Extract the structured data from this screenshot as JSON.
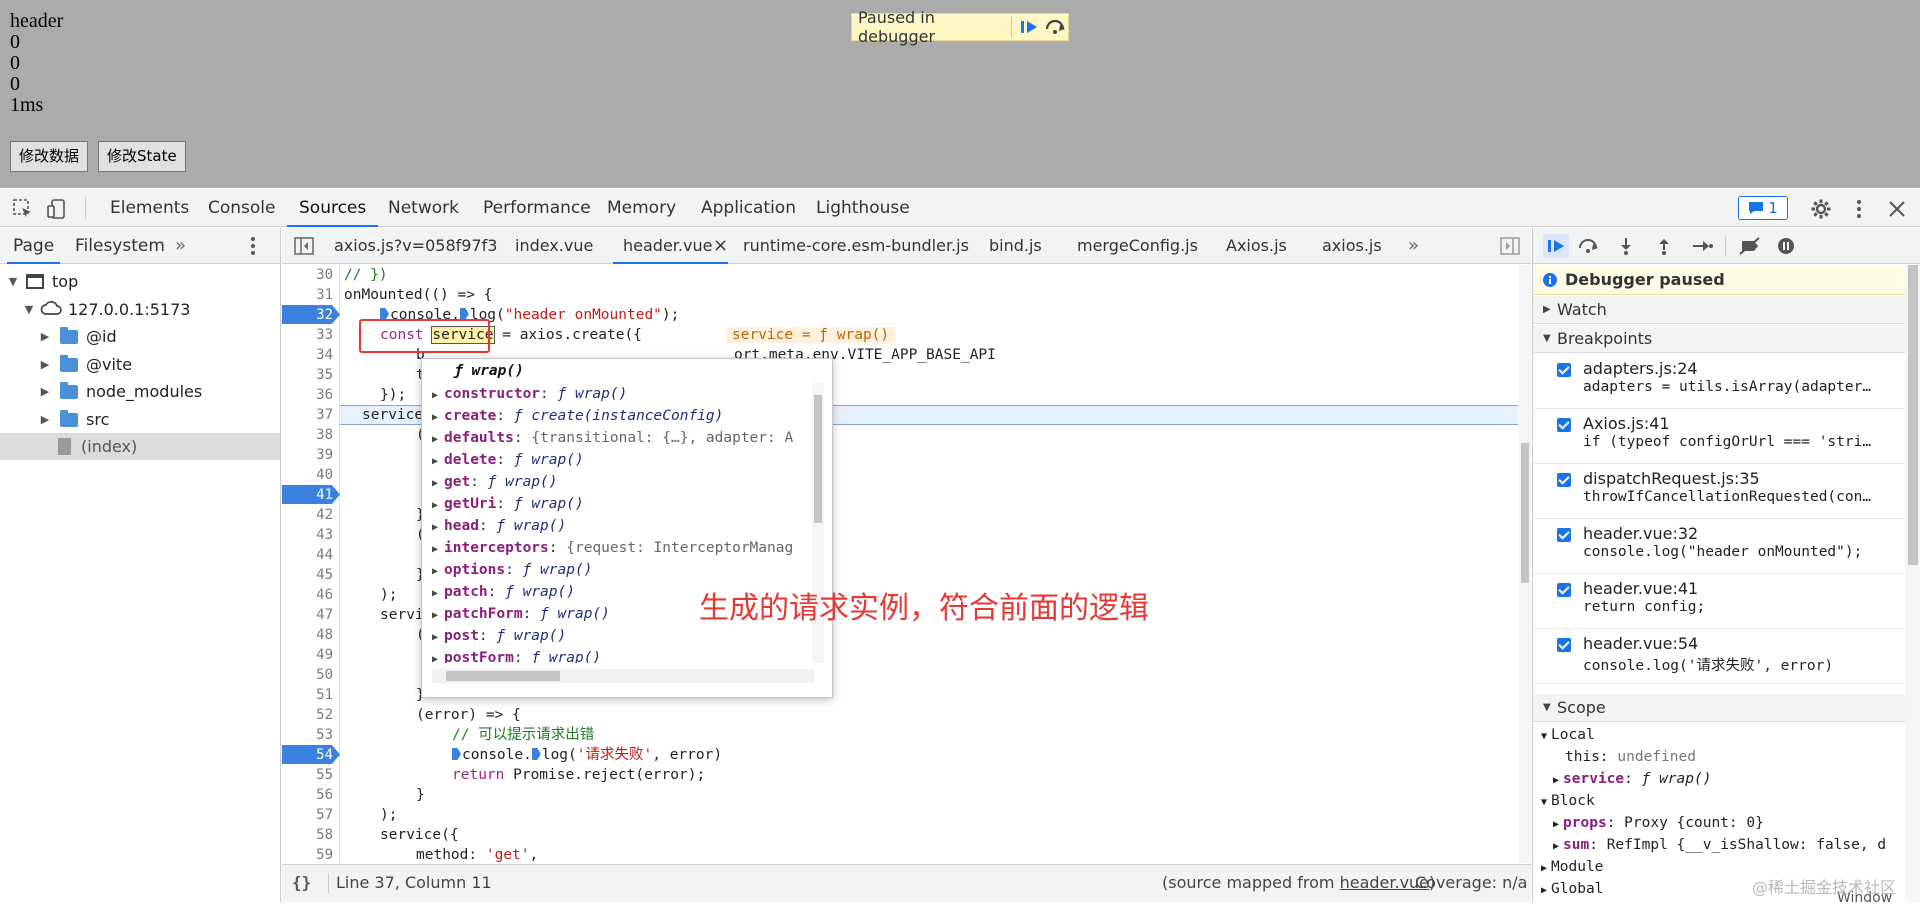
{
  "preview": {
    "lines": [
      "header",
      "0",
      "0",
      "0",
      "1ms"
    ],
    "buttons": [
      "修改数据",
      "修改State"
    ],
    "paused_label": "Paused in debugger"
  },
  "devtools": {
    "tabs": [
      "Elements",
      "Console",
      "Sources",
      "Network",
      "Performance",
      "Memory",
      "Application",
      "Lighthouse"
    ],
    "active_tab": "Sources",
    "issues_count": "1"
  },
  "navigator": {
    "tabs": [
      "Page",
      "Filesystem"
    ],
    "more": "»",
    "tree": [
      {
        "label": "top",
        "level": 0,
        "kind": "frame"
      },
      {
        "label": "127.0.0.1:5173",
        "level": 1,
        "kind": "origin"
      },
      {
        "label": "@id",
        "level": 2,
        "kind": "folder"
      },
      {
        "label": "@vite",
        "level": 2,
        "kind": "folder"
      },
      {
        "label": "node_modules",
        "level": 2,
        "kind": "folder"
      },
      {
        "label": "src",
        "level": 2,
        "kind": "folder"
      },
      {
        "label": "(index)",
        "level": 2,
        "kind": "file"
      }
    ]
  },
  "editor": {
    "file_tabs": [
      "axios.js?v=058f97f3",
      "index.vue",
      "header.vue",
      "runtime-core.esm-bundler.js",
      "bind.js",
      "mergeConfig.js",
      "Axios.js",
      "axios.js"
    ],
    "active_file": "header.vue",
    "close_glyph": "×",
    "more": "»",
    "line_numbers": [
      "30",
      "31",
      "32",
      "33",
      "34",
      "35",
      "36",
      "37",
      "38",
      "39",
      "40",
      "41",
      "42",
      "43",
      "44",
      "45",
      "46",
      "47",
      "48",
      "49",
      "50",
      "51",
      "52",
      "53",
      "54",
      "55",
      "56",
      "57",
      "58",
      "59"
    ],
    "breakpoint_lines": [
      "32",
      "41",
      "54"
    ],
    "code": {
      "l30": "// })",
      "l31": "onMounted(() => {",
      "l32a": "console.",
      "l32b": "log(",
      "l32c": "\"header onMounted\"",
      "l32d": ");",
      "l33a": "const",
      "l33b": "service",
      "l33c": " = axios.create({",
      "l33hint": "service = ƒ wrap()",
      "l34": "b",
      "l34b": "ort.meta.env.VITE_APP_BASE_API",
      "l35": "t",
      "l36": "});",
      "l37": "service",
      "l38": "(",
      "l42": "}",
      "l43": "(",
      "l45": "}",
      "l46": ");",
      "l47": "servi",
      "l48": "(",
      "l51": "}",
      "l52": "(error) => {",
      "l53": "// 可以提示请求出错",
      "l54a": "console.",
      "l54b": "log(",
      "l54c": "'请求失败'",
      "l54d": ", error)",
      "l55a": "return",
      "l55b": " Promise.reject(error);",
      "l56": "}",
      "l57": ");",
      "l58": "service({",
      "l59a": "method: ",
      "l59b": "'get'",
      "l59c": ","
    },
    "status_position": "Line 37, Column 11",
    "status_source_prefix": "(source mapped from ",
    "status_source_file": "header.vue",
    "status_source_suffix": ")",
    "status_coverage": "Coverage: n/a",
    "braces": "{}"
  },
  "popover": {
    "title": "ƒ wrap()",
    "rows": [
      {
        "key": "constructor",
        "val": "ƒ wrap()"
      },
      {
        "key": "create",
        "val": "ƒ create(instanceConfig)"
      },
      {
        "key": "defaults",
        "val": "{transitional: {…}, adapter: A"
      },
      {
        "key": "delete",
        "val": "ƒ wrap()"
      },
      {
        "key": "get",
        "val": "ƒ wrap()"
      },
      {
        "key": "getUri",
        "val": "ƒ wrap()"
      },
      {
        "key": "head",
        "val": "ƒ wrap()"
      },
      {
        "key": "interceptors",
        "val": "{request: InterceptorManag"
      },
      {
        "key": "options",
        "val": "ƒ wrap()"
      },
      {
        "key": "patch",
        "val": "ƒ wrap()"
      },
      {
        "key": "patchForm",
        "val": "ƒ wrap()"
      },
      {
        "key": "post",
        "val": "ƒ wrap()"
      },
      {
        "key": "postForm",
        "val": "ƒ wrap()"
      }
    ]
  },
  "annotation": "生成的请求实例，符合前面的逻辑",
  "debugger": {
    "paused_title": "Debugger paused",
    "sections": {
      "watch": "Watch",
      "breakpoints": "Breakpoints",
      "scope": "Scope"
    },
    "breakpoints": [
      {
        "file": "adapters.js:24",
        "src": "adapters = utils.isArray(adapter…"
      },
      {
        "file": "Axios.js:41",
        "src": "if (typeof configOrUrl === 'stri…"
      },
      {
        "file": "dispatchRequest.js:35",
        "src": "throwIfCancellationRequested(con…"
      },
      {
        "file": "header.vue:32",
        "src": "console.log(\"header onMounted\");"
      },
      {
        "file": "header.vue:41",
        "src": "return config;"
      },
      {
        "file": "header.vue:54",
        "src": "console.log('请求失败', error)"
      }
    ],
    "scope": {
      "local": "Local",
      "this_key": "this",
      "this_val": "undefined",
      "service_key": "service",
      "service_val": "ƒ wrap()",
      "block": "Block",
      "props_key": "props",
      "props_val": "Proxy {count: 0}",
      "sum_key": "sum",
      "sum_val": "RefImpl {__v_isShallow: false, d",
      "module": "Module",
      "global": "Global",
      "global_val": "Window"
    }
  },
  "watermark": "@稀土掘金技术社区",
  "colors": {
    "accent": "#1a73e8",
    "breakpoint": "#3b82e0",
    "annotation": "#e53935",
    "preview_bg": "#ababab"
  }
}
